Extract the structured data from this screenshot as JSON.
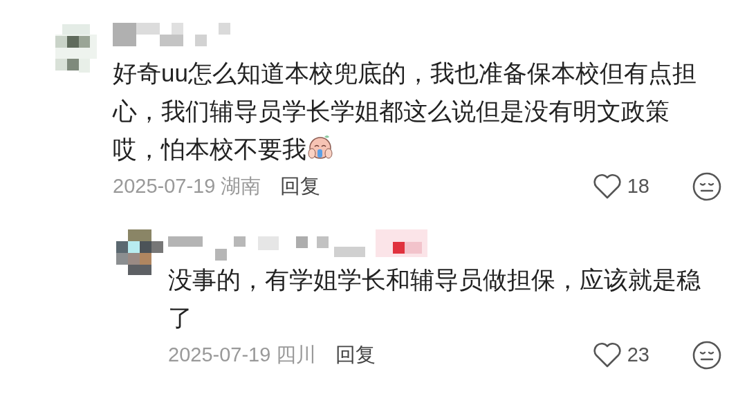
{
  "comments": [
    {
      "kind": "comment",
      "lines": [
        "好奇uu怎么知道本校兜底的，我也准备保本校但有点担",
        "心，我们辅导员学长学姐都这么说但是没有明文政策",
        "哎，怕本校不要我"
      ],
      "sticker": true,
      "date": "2025-07-19",
      "location": "湖南",
      "reply_label": "回复",
      "likes": "18"
    },
    {
      "kind": "reply",
      "lines": [
        "没事的，有学姐学长和辅导员做担保，应该就是稳",
        "了"
      ],
      "sticker": false,
      "date": "2025-07-19",
      "location": "四川",
      "reply_label": "回复",
      "likes": "23"
    }
  ]
}
